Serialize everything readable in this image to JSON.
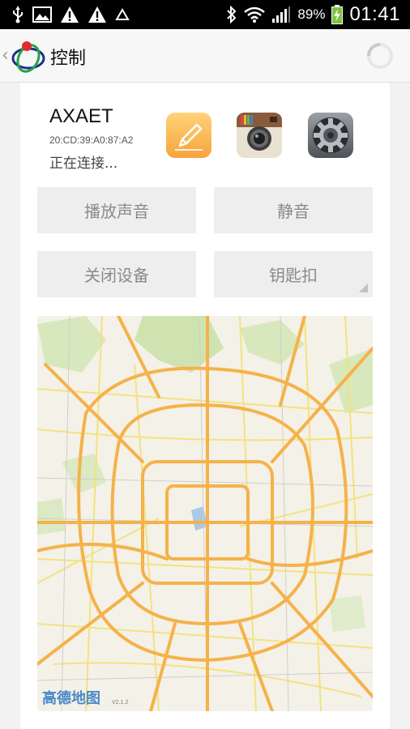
{
  "status_bar": {
    "battery_percent": "89%",
    "time": "01:41",
    "left_icons": [
      "usb-icon",
      "image-icon",
      "warning-icon",
      "warning-icon",
      "triangle-outline-icon"
    ],
    "right_icons": [
      "bluetooth-icon",
      "wifi-icon",
      "signal-icon",
      "battery-charging-icon"
    ]
  },
  "action_bar": {
    "title": "控制",
    "icons": [
      "back-chevron-icon",
      "app-logo-icon",
      "loading-spinner-icon"
    ]
  },
  "device": {
    "name": "AXAET",
    "mac": "20:CD:39:A0:87:A2",
    "status": "正在连接..."
  },
  "app_icons": [
    "notes-pencil-icon",
    "camera-app-icon",
    "settings-gear-icon"
  ],
  "buttons": {
    "play_sound": "播放声音",
    "mute": "静音",
    "close_device": "关闭设备",
    "keychain": "钥匙扣"
  },
  "map": {
    "logo_text": "高德地图",
    "version": "V2.1.2"
  },
  "colors": {
    "accent_road": "#f5b24a",
    "secondary_road": "#f3e27a",
    "park": "#cfe3b0",
    "button_bg": "#eeeeee",
    "button_text": "#8a8a8a"
  }
}
